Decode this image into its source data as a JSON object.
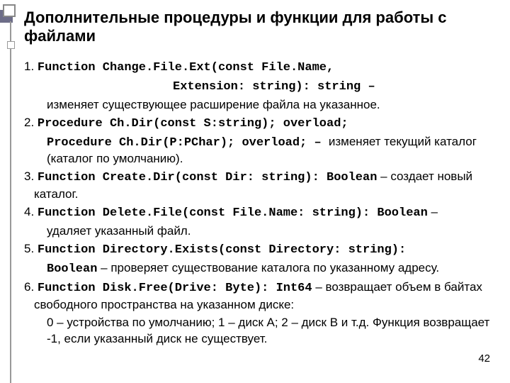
{
  "title": "Дополнительные процедуры и функции для работы с файлами",
  "items": [
    {
      "num": "1.",
      "code": "Function Change.File.Ext(const File.Name,",
      "code2": "Extension: string): string",
      "dash": " –",
      "desc": "изменяет существующее расширение файла на указанное."
    },
    {
      "num": "2.",
      "code": "Procedure Ch.Dir(const S:string); overload;",
      "code2a": "Procedure Ch.Dir(P:PChar); overload;",
      "dash": " – ",
      "desc": "изменяет текущий каталог (каталог по умолчанию)."
    },
    {
      "num": "3.",
      "code": "Function Create.Dir(const Dir: string): Boolean",
      "dash": " – ",
      "desc": "создает новый каталог."
    },
    {
      "num": "4.",
      "code": "Function Delete.File(const File.Name: string): Boolean",
      "dash": " – ",
      "desc": "удаляет указанный файл."
    },
    {
      "num": "5.",
      "code": "Function Directory.Exists(const Directory: string): Boolean",
      "dash": " – ",
      "desc": "проверяет существование каталога по указанному адресу."
    },
    {
      "num": "6.",
      "code": "Function Disk.Free(Drive: Byte): Int64",
      "dash": " – ",
      "desc": "возвращает объем в байтах свободного пространства на указанном диске:",
      "desc2": "0 – устройства по умолчанию; 1 – диск А; 2 – диск В и т.д. Функция возвращает -1, если указанный диск не существует."
    }
  ],
  "pagenum": "42"
}
